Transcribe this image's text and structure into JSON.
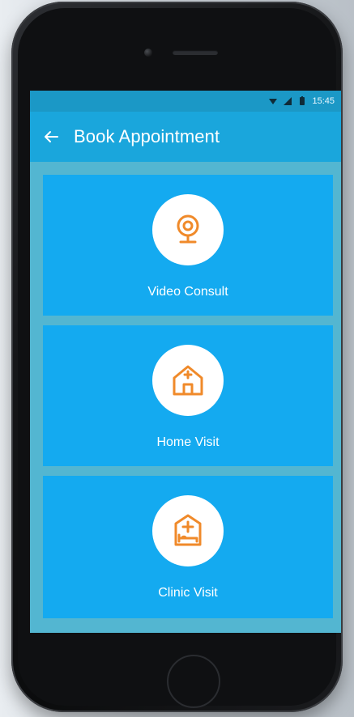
{
  "status": {
    "time": "15:45",
    "icons": [
      "wifi-icon",
      "signal-icon",
      "battery-icon"
    ]
  },
  "app_bar": {
    "title": "Book Appointment",
    "back_icon": "back-arrow-icon"
  },
  "options": [
    {
      "label": "Video Consult",
      "icon": "webcam-icon"
    },
    {
      "label": "Home Visit",
      "icon": "home-medical-icon"
    },
    {
      "label": "Clinic Visit",
      "icon": "clinic-bed-icon"
    }
  ],
  "colors": {
    "status_bar": "#1b98c6",
    "app_bar": "#1aa6dc",
    "card": "#14aaf0",
    "screen_bg": "#53b6d1",
    "icon_accent": "#f08a2a",
    "icon_circle": "#ffffff"
  }
}
